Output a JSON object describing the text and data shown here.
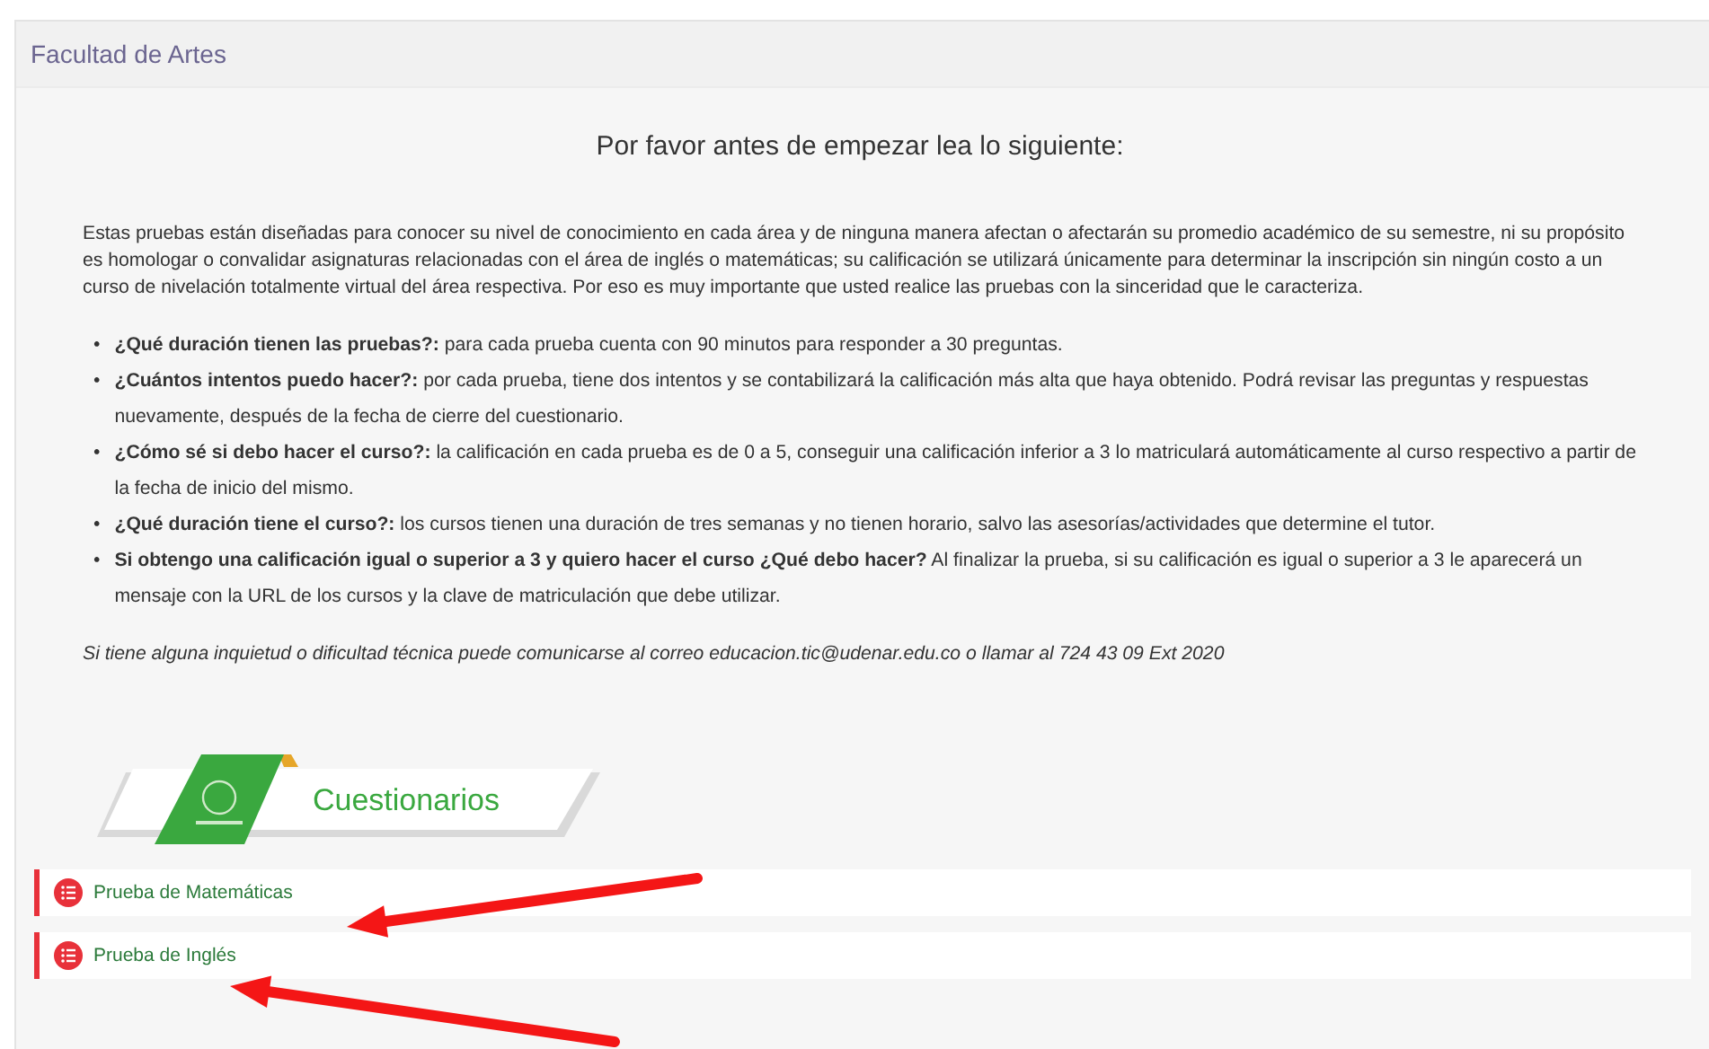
{
  "panel": {
    "title": "Facultad de Artes"
  },
  "heading": "Por favor antes de empezar lea lo siguiente:",
  "intro": "Estas pruebas están diseñadas para conocer su nivel de conocimiento en cada área y de ninguna manera afectan o afectarán su promedio académico de su semestre, ni su propósito es homologar o convalidar asignaturas relacionadas con el área de inglés o matemáticas; su calificación se utilizará únicamente para determinar la inscripción sin ningún costo a un curso de nivelación totalmente virtual del área respectiva. Por eso es muy importante que usted realice las pruebas con la sinceridad que le caracteriza.",
  "faq": [
    {
      "bullet": "•",
      "text": "**¿Qué duración tienen las pruebas?:** para cada prueba cuenta con 90 minutos para responder a 30 preguntas."
    },
    {
      "bullet": "•",
      "text": "**¿Cuántos intentos puedo hacer?:** por cada prueba, tiene dos intentos y se contabilizará la calificación más alta que haya obtenido. Podrá revisar las preguntas y respuestas nuevamente, después de la fecha de cierre del cuestionario."
    },
    {
      "bullet": "•",
      "text": "**¿Cómo sé si debo hacer el curso?:** la calificación en cada prueba es de 0 a 5, conseguir una calificación inferior a 3 lo matriculará automáticamente al curso respectivo a partir de la fecha de inicio del mismo."
    },
    {
      "bullet": "•",
      "text": "**¿Qué duración tiene el curso?:** los cursos tienen una duración de tres semanas y no tienen horario, salvo las asesorías/actividades que determine el tutor."
    },
    {
      "bullet": "•",
      "text": "**Si obtengo una calificación igual o superior a 3 y quiero hacer el curso ¿Qué debo hacer?**  Al finalizar la prueba, si su calificación es igual o superior a 3 le aparecerá un mensaje con la URL de los cursos y la clave de matriculación que debe utilizar."
    }
  ],
  "contact": "Si tiene alguna inquietud o dificultad técnica puede comunicarse al correo educacion.tic@udenar.edu.co o llamar al 724 43 09 Ext 2020",
  "banner": {
    "title": "Cuestionarios"
  },
  "quizzes": [
    {
      "label": "Prueba de Matemáticas"
    },
    {
      "label": "Prueba de Inglés"
    }
  ]
}
